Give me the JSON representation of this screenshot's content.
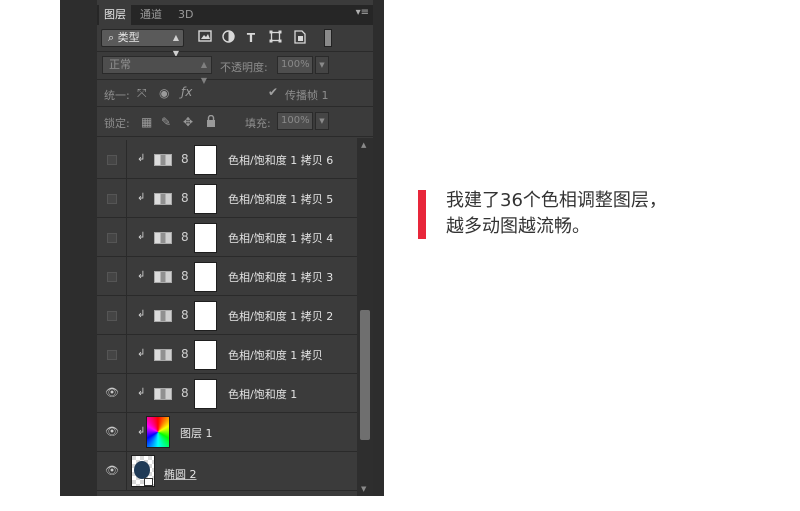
{
  "panel": {
    "tabs": [
      {
        "label": "图层",
        "active": true
      },
      {
        "label": "通道",
        "active": false
      },
      {
        "label": "3D",
        "active": false
      }
    ],
    "menu_glyph": "▾≡",
    "filter": {
      "search_glyph": "⌕",
      "kind_label": "类型",
      "icons": [
        "image-filter-icon",
        "adjustment-filter-icon",
        "type-filter-icon",
        "shape-filter-icon",
        "smart-object-filter-icon"
      ],
      "type_glyph": "T"
    },
    "blend_mode": "正常",
    "opacity_label": "不透明度:",
    "opacity_value": "100%",
    "unify_label": "统一:",
    "propagate_label": "传播帧 1",
    "lock_label": "锁定:",
    "fill_label": "填充:",
    "fill_value": "100%"
  },
  "layers": [
    {
      "name": "色相/饱和度 1 拷贝 6",
      "visible": false,
      "kind": "adjustment"
    },
    {
      "name": "色相/饱和度 1 拷贝 5",
      "visible": false,
      "kind": "adjustment"
    },
    {
      "name": "色相/饱和度 1 拷贝 4",
      "visible": false,
      "kind": "adjustment"
    },
    {
      "name": "色相/饱和度 1 拷贝 3",
      "visible": false,
      "kind": "adjustment"
    },
    {
      "name": "色相/饱和度 1 拷贝 2",
      "visible": false,
      "kind": "adjustment"
    },
    {
      "name": "色相/饱和度 1 拷贝",
      "visible": false,
      "kind": "adjustment"
    },
    {
      "name": "色相/饱和度 1",
      "visible": true,
      "kind": "adjustment"
    },
    {
      "name": "图层 1",
      "visible": true,
      "kind": "pixel"
    },
    {
      "name": "椭圆 2",
      "visible": true,
      "kind": "shape"
    }
  ],
  "caption": {
    "line1": "我建了36个色相调整图层，",
    "line2": "越多动图越流畅。",
    "accent_color": "#e8263a"
  }
}
